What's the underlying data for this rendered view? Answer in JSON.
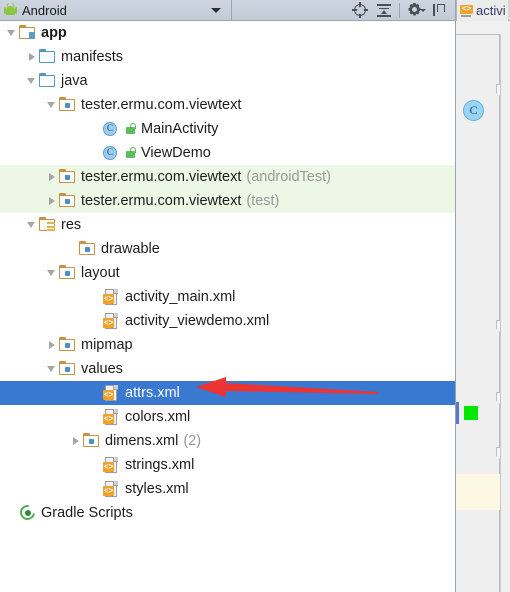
{
  "toolbar": {
    "logo_icon": "android-logo-icon",
    "title": "Android",
    "caret_icon": "chevron-down-icon",
    "buttons": [
      {
        "name": "select-opened-file-icon",
        "label": "Select Opened File"
      },
      {
        "name": "collapse-all-icon",
        "label": "Collapse All"
      },
      {
        "name": "gear-settings-icon",
        "label": "Settings"
      },
      {
        "name": "hide-panel-icon",
        "label": "Hide"
      }
    ]
  },
  "tree": {
    "rows": [
      {
        "label": "app",
        "suffix": "",
        "indent": 6,
        "twisty": "down",
        "icon": "module-folder-icon",
        "bold": true,
        "selected": false,
        "test": false
      },
      {
        "label": "manifests",
        "suffix": "",
        "indent": 26,
        "twisty": "right",
        "icon": "folder-icon",
        "bold": false,
        "selected": false,
        "test": false
      },
      {
        "label": "java",
        "suffix": "",
        "indent": 26,
        "twisty": "down",
        "icon": "folder-icon",
        "bold": false,
        "selected": false,
        "test": false
      },
      {
        "label": "tester.ermu.com.viewtext",
        "suffix": "",
        "indent": 46,
        "twisty": "down",
        "icon": "package-folder-icon",
        "bold": false,
        "selected": false,
        "test": false
      },
      {
        "label": "MainActivity",
        "suffix": "",
        "indent": 90,
        "twisty": "none",
        "icon": "java-class-icon",
        "bold": false,
        "selected": false,
        "test": false
      },
      {
        "label": "ViewDemo",
        "suffix": "",
        "indent": 90,
        "twisty": "none",
        "icon": "java-class-icon",
        "bold": false,
        "selected": false,
        "test": false
      },
      {
        "label": "tester.ermu.com.viewtext",
        "suffix": "(androidTest)",
        "indent": 46,
        "twisty": "right",
        "icon": "package-folder-icon",
        "bold": false,
        "selected": false,
        "test": true
      },
      {
        "label": "tester.ermu.com.viewtext",
        "suffix": "(test)",
        "indent": 46,
        "twisty": "right",
        "icon": "package-folder-icon",
        "bold": false,
        "selected": false,
        "test": true
      },
      {
        "label": "res",
        "suffix": "",
        "indent": 26,
        "twisty": "down",
        "icon": "res-folder-icon",
        "bold": false,
        "selected": false,
        "test": false
      },
      {
        "label": "drawable",
        "suffix": "",
        "indent": 66,
        "twisty": "none",
        "icon": "package-folder-icon",
        "bold": false,
        "selected": false,
        "test": false
      },
      {
        "label": "layout",
        "suffix": "",
        "indent": 46,
        "twisty": "down",
        "icon": "package-folder-icon",
        "bold": false,
        "selected": false,
        "test": false
      },
      {
        "label": "activity_main.xml",
        "suffix": "",
        "indent": 90,
        "twisty": "none",
        "icon": "xml-file-icon",
        "bold": false,
        "selected": false,
        "test": false
      },
      {
        "label": "activity_viewdemo.xml",
        "suffix": "",
        "indent": 90,
        "twisty": "none",
        "icon": "xml-file-icon",
        "bold": false,
        "selected": false,
        "test": false
      },
      {
        "label": "mipmap",
        "suffix": "",
        "indent": 46,
        "twisty": "right",
        "icon": "package-folder-icon",
        "bold": false,
        "selected": false,
        "test": false
      },
      {
        "label": "values",
        "suffix": "",
        "indent": 46,
        "twisty": "down",
        "icon": "package-folder-icon",
        "bold": false,
        "selected": false,
        "test": false
      },
      {
        "label": "attrs.xml",
        "suffix": "",
        "indent": 90,
        "twisty": "none",
        "icon": "xml-file-icon",
        "bold": false,
        "selected": true,
        "test": false
      },
      {
        "label": "colors.xml",
        "suffix": "",
        "indent": 90,
        "twisty": "none",
        "icon": "xml-file-icon",
        "bold": false,
        "selected": false,
        "test": false
      },
      {
        "label": "dimens.xml",
        "suffix": "(2)",
        "indent": 70,
        "twisty": "right",
        "icon": "package-folder-icon",
        "bold": false,
        "selected": false,
        "test": false
      },
      {
        "label": "strings.xml",
        "suffix": "",
        "indent": 90,
        "twisty": "none",
        "icon": "xml-file-icon",
        "bold": false,
        "selected": false,
        "test": false
      },
      {
        "label": "styles.xml",
        "suffix": "",
        "indent": 90,
        "twisty": "none",
        "icon": "xml-file-icon",
        "bold": false,
        "selected": false,
        "test": false
      },
      {
        "label": "Gradle Scripts",
        "suffix": "",
        "indent": 6,
        "twisty": "none",
        "icon": "gradle-icon",
        "bold": false,
        "selected": false,
        "test": false
      }
    ],
    "selected_row_color": "#3a79d1",
    "test_row_color": "#edf7e6",
    "xml_badge_text": "<>"
  },
  "annotation": {
    "arrow_icon": "red-arrow-pointing-left",
    "color": "#ee3333"
  },
  "editor": {
    "tab_label": "activi",
    "tab_icon": "xml-file-icon",
    "gutter_marker_letter": "C",
    "green_marker_color": "#00e800",
    "highlight_color": "#fdf8e3",
    "fold_icons": [
      "fold-collapse-icon",
      "fold-collapse-icon",
      "fold-collapse-icon"
    ]
  }
}
